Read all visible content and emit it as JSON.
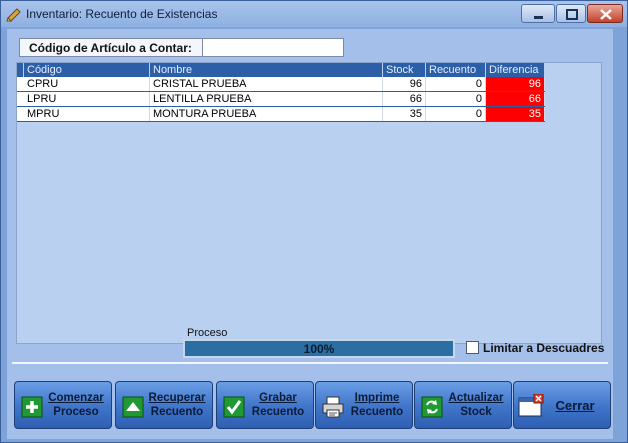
{
  "window": {
    "title": "Inventario: Recuento de Existencias"
  },
  "code_field": {
    "label": "Código de Artículo a Contar:",
    "value": ""
  },
  "grid": {
    "columns": [
      "Código",
      "Nombre",
      "Stock",
      "Recuento",
      "Diferencia"
    ],
    "rows": [
      {
        "codigo": "CPRU",
        "nombre": "CRISTAL PRUEBA",
        "stock": "96",
        "recuento": "0",
        "diferencia": "96"
      },
      {
        "codigo": "LPRU",
        "nombre": "LENTILLA PRUEBA",
        "stock": "66",
        "recuento": "0",
        "diferencia": "66"
      },
      {
        "codigo": "MPRU",
        "nombre": "MONTURA PRUEBA",
        "stock": "35",
        "recuento": "0",
        "diferencia": "35"
      }
    ]
  },
  "proceso": {
    "label": "Proceso",
    "text": "100%",
    "value": 1.0
  },
  "limitar": {
    "label": "Limitar a Descuadres",
    "checked": false
  },
  "buttons": {
    "comenzar": {
      "line1": "Comenzar",
      "line2": "Proceso",
      "icon": "plus-icon"
    },
    "recuperar": {
      "line1": "Recuperar",
      "line2": "Recuento",
      "icon": "up-arrow-icon"
    },
    "grabar": {
      "line1": "Grabar",
      "line2": "Recuento",
      "icon": "checkmark-icon"
    },
    "imprime": {
      "line1": "Imprime",
      "line2": "Recuento",
      "icon": "printer-icon"
    },
    "actualizar": {
      "line1": "Actualizar",
      "line2": "Stock",
      "icon": "refresh-icon"
    },
    "cerrar": {
      "line1": "Cerrar",
      "icon": "close-window-icon"
    }
  },
  "colors": {
    "header": "#2c5fa8",
    "diff_background": "#ff0000",
    "window_background": "#a4c0ea"
  }
}
